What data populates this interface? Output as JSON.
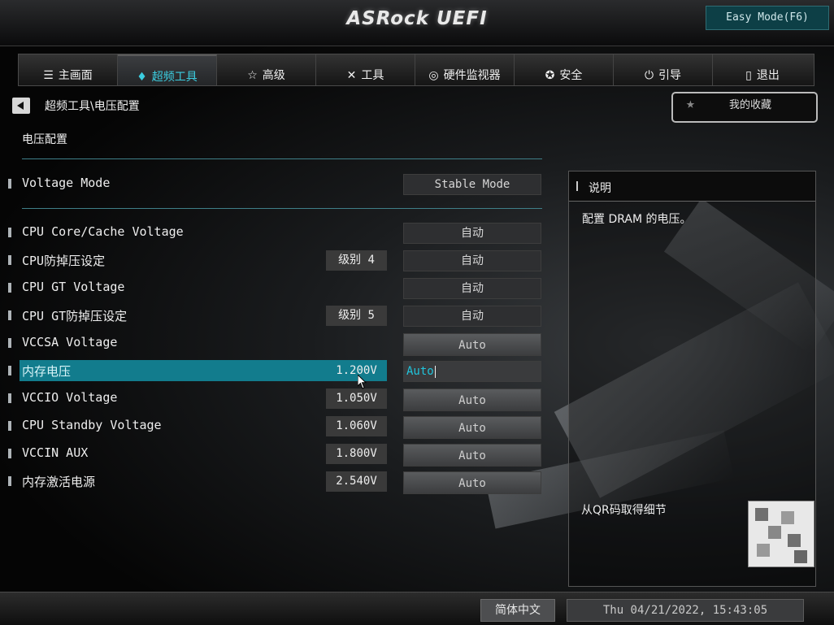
{
  "header": {
    "logo": "ASRock UEFI",
    "easy_mode_label": "Easy Mode(F6)"
  },
  "tabs": [
    {
      "label": "主画面",
      "icon": "list-icon"
    },
    {
      "label": "超频工具",
      "icon": "flame-icon",
      "active": true
    },
    {
      "label": "高级",
      "icon": "star-icon"
    },
    {
      "label": "工具",
      "icon": "tools-icon"
    },
    {
      "label": "硬件监视器",
      "icon": "monitor-icon"
    },
    {
      "label": "安全",
      "icon": "shield-icon"
    },
    {
      "label": "引导",
      "icon": "power-icon"
    },
    {
      "label": "退出",
      "icon": "exit-icon"
    }
  ],
  "breadcrumb": "超频工具\\电压配置",
  "favorites_label": "我的收藏",
  "page_title": "电压配置",
  "voltage_mode": {
    "label": "Voltage Mode",
    "option": "Stable Mode"
  },
  "rows": [
    {
      "label": "CPU Core/Cache Voltage",
      "value": "",
      "option": "自动"
    },
    {
      "label": "CPU防掉压设定",
      "value": "级别 4",
      "option": "自动"
    },
    {
      "label": "CPU GT Voltage",
      "value": "",
      "option": "自动"
    },
    {
      "label": "CPU GT防掉压设定",
      "value": "级别 5",
      "option": "自动"
    },
    {
      "label": "VCCSA Voltage",
      "value": "",
      "option": "Auto"
    },
    {
      "label": "内存电压",
      "value": "1.200V",
      "option": "Auto",
      "selected": true
    },
    {
      "label": "VCCIO Voltage",
      "value": "1.050V",
      "option": "Auto"
    },
    {
      "label": "CPU Standby Voltage",
      "value": "1.060V",
      "option": "Auto"
    },
    {
      "label": "VCCIN AUX",
      "value": "1.800V",
      "option": "Auto"
    },
    {
      "label": "内存激活电源",
      "value": "2.540V",
      "option": "Auto"
    }
  ],
  "help": {
    "title": "说明",
    "text": "配置 DRAM 的电压。",
    "qr_label": "从QR码取得细节"
  },
  "footer": {
    "language": "简体中文",
    "datetime": "Thu 04/21/2022, 15:43:05"
  },
  "colors": {
    "accent": "#127c8d",
    "accent_text": "#20c4dc"
  }
}
